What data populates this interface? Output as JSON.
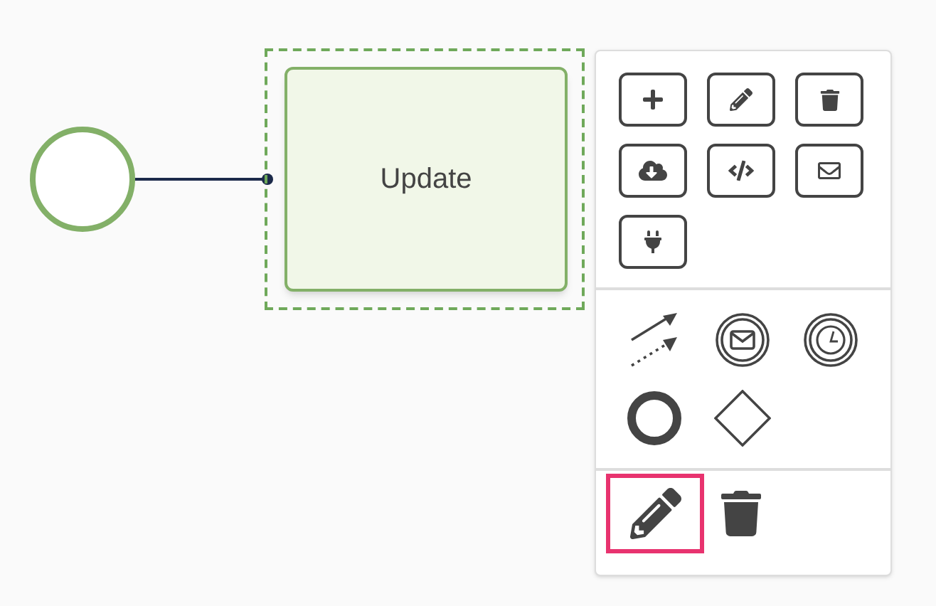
{
  "diagram": {
    "start_event": {
      "kind": "start-event"
    },
    "task": {
      "label": "Update",
      "selected": true
    }
  },
  "context_pad": {
    "actions": [
      {
        "kind": "append"
      },
      {
        "kind": "edit"
      },
      {
        "kind": "delete"
      },
      {
        "kind": "download"
      },
      {
        "kind": "code"
      },
      {
        "kind": "mail"
      },
      {
        "kind": "plug"
      }
    ],
    "shapes": [
      {
        "kind": "connections"
      },
      {
        "kind": "message-event"
      },
      {
        "kind": "timer-event"
      },
      {
        "kind": "end-event"
      },
      {
        "kind": "gateway"
      }
    ],
    "tools": [
      {
        "kind": "edit",
        "selected": true
      },
      {
        "kind": "delete",
        "selected": false
      }
    ]
  }
}
